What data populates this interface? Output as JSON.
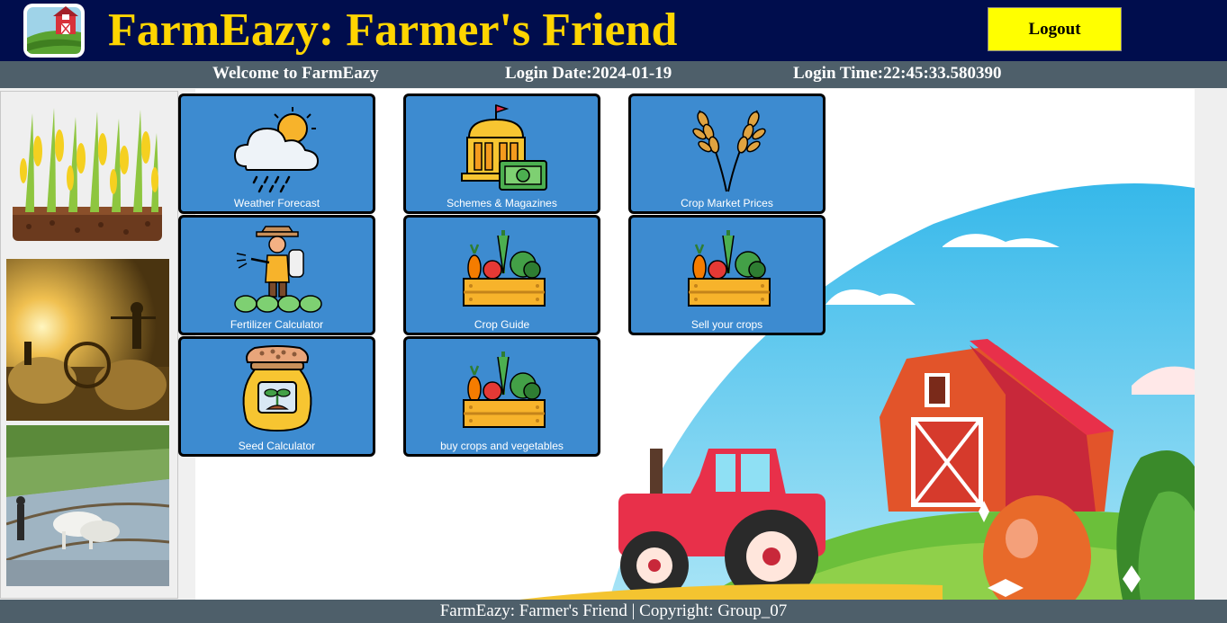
{
  "header": {
    "title": "FarmEazy: Farmer's Friend",
    "logout_label": "Logout"
  },
  "infobar": {
    "welcome": "Welcome to FarmEazy",
    "login_date": "Login Date:2024-01-19",
    "login_time": "Login Time:22:45:33.580390"
  },
  "tiles": [
    {
      "label": "Weather Forecast",
      "icon": "weather-icon"
    },
    {
      "label": "Schemes & Magazines",
      "icon": "bank-money-icon"
    },
    {
      "label": "Crop Market Prices",
      "icon": "wheat-icon"
    },
    {
      "label": "Fertilizer Calculator",
      "icon": "farmer-sprayer-icon"
    },
    {
      "label": "Crop Guide",
      "icon": "vegetable-crate-icon"
    },
    {
      "label": "Sell your crops",
      "icon": "vegetable-crate-icon"
    },
    {
      "label": "Seed Calculator",
      "icon": "seed-bag-icon"
    },
    {
      "label": "buy crops and vegetables",
      "icon": "vegetable-crate-icon"
    }
  ],
  "sidebar": {
    "images": [
      "corn-plants-image",
      "harvest-sunset-image",
      "ox-plough-field-image"
    ]
  },
  "footer": {
    "text": "FarmEazy: Farmer's Friend | Copyright: Group_07"
  },
  "colors": {
    "header_bg": "#000d4d",
    "title_yellow": "#ffd500",
    "logout_bg": "#ffff00",
    "bar_bg": "#4e5f6a",
    "tile_bg": "#3d8bd0"
  }
}
